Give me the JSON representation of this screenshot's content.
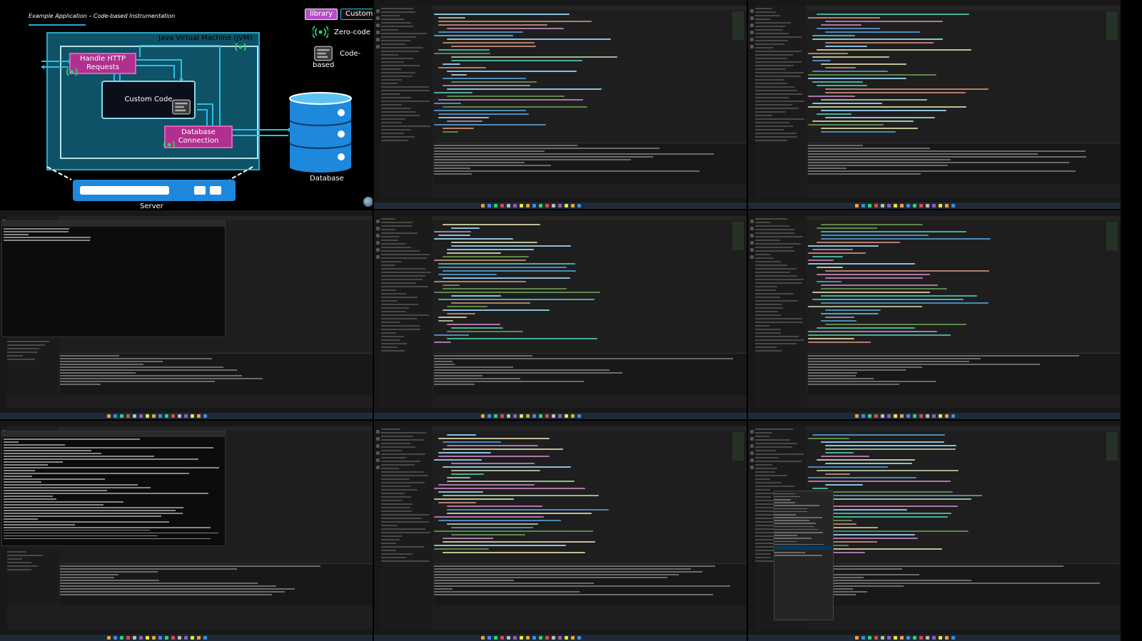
{
  "diagram": {
    "title": "Example Application – Code-based Instrumentation",
    "chip_library": "library",
    "chip_custom": "Custom",
    "legend_zero_code": "Zero-code",
    "legend_code_based": "Code-based",
    "jvm_label": "Java Virtual Machine (JVM)",
    "http_label": "Handle HTTP Requests",
    "custom_code_label": "Custom Code",
    "db_conn_label": "Database Connection",
    "database_label": "Database",
    "server_label": "Server",
    "colors": {
      "jvm_fill": "#0d5266",
      "pink": "#b0308f",
      "cyan": "#29c0e8",
      "green": "#2dd36f",
      "db_blue": "#1e88dd"
    }
  },
  "ide_tiles": [
    {
      "id": "ide-1",
      "variant": "code"
    },
    {
      "id": "ide-2",
      "variant": "code"
    },
    {
      "id": "ide-3",
      "variant": "terminal"
    },
    {
      "id": "ide-4",
      "variant": "code"
    },
    {
      "id": "ide-5",
      "variant": "code"
    },
    {
      "id": "ide-6",
      "variant": "terminal"
    },
    {
      "id": "ide-7",
      "variant": "code"
    },
    {
      "id": "ide-8",
      "variant": "code-menu"
    }
  ],
  "icons": [
    "broadcast-icon",
    "code-based-icon",
    "database-icon",
    "server-icon",
    "avatar"
  ]
}
